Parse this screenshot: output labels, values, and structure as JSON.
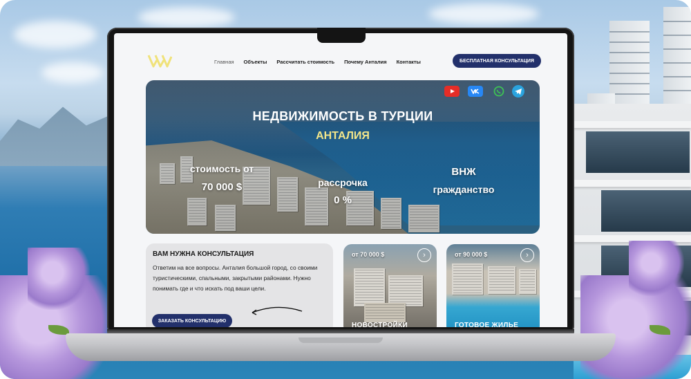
{
  "nav": {
    "links": [
      "Главная",
      "Объекты",
      "Рассчитать стоимость",
      "Почему Анталия",
      "Контакты"
    ],
    "cta": "БЕСПЛАТНАЯ КОНСУЛЬТАЦИЯ"
  },
  "hero": {
    "title": "НЕДВИЖИМОСТЬ В ТУРЦИИ",
    "subtitle": "АНТАЛИЯ",
    "price_label": "стоимость от",
    "price_value": "70 000 $",
    "installment_label": "рассрочка",
    "installment_value": "0 %",
    "residency": "ВНЖ",
    "citizenship": "гражданство"
  },
  "consult": {
    "title": "ВАМ НУЖНА КОНСУЛЬТАЦИЯ",
    "text": "Ответим на все вопросы. Анталия большой город, со своими туристическими, спальными, закрытыми районами. Нужно понимать где и что искать под ваши цели.",
    "button": "ЗАКАЗАТЬ КОНСУЛЬТАЦИЮ"
  },
  "cards": [
    {
      "price": "от 70 000 $",
      "caption": "НОВОСТРОЙКИ"
    },
    {
      "price": "от 90 000 $",
      "caption": "ГОТОВОЕ ЖИЛЬЕ"
    }
  ],
  "colors": {
    "accent": "#22306b",
    "logo": "#f0e27a",
    "subtitle": "#f3e68a"
  },
  "icons": [
    "youtube-icon",
    "vk-icon",
    "whatsapp-icon",
    "telegram-icon",
    "arrow-right-icon"
  ]
}
